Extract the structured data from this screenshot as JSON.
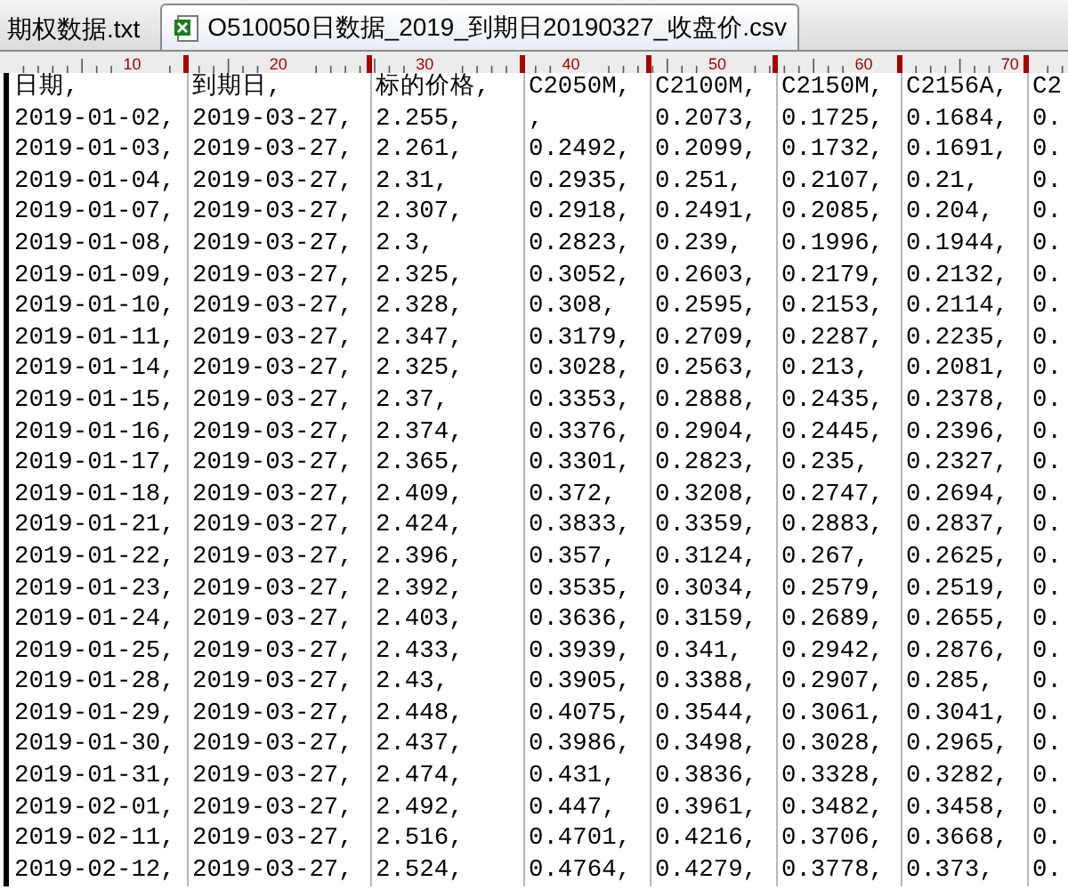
{
  "tabs": [
    {
      "label": "期权数据.txt",
      "selected": false
    },
    {
      "label": "O510050日数据_2019_到期日20190327_收盘价.csv",
      "selected": true
    }
  ],
  "ruler": {
    "labels": [
      "10",
      "20",
      "30",
      "40",
      "50",
      "60",
      "70"
    ]
  },
  "table": {
    "columns": [
      "日期,",
      "到期日,",
      "标的价格,",
      "C2050M,",
      "C2100M,",
      "C2150M,",
      "C2156A,",
      "C2"
    ],
    "rows": [
      [
        "2019-01-02,",
        "2019-03-27,",
        "2.255,",
        ",",
        "0.2073,",
        "0.1725,",
        "0.1684,",
        "0."
      ],
      [
        "2019-01-03,",
        "2019-03-27,",
        "2.261,",
        "0.2492,",
        "0.2099,",
        "0.1732,",
        "0.1691,",
        "0."
      ],
      [
        "2019-01-04,",
        "2019-03-27,",
        "2.31,",
        "0.2935,",
        "0.251,",
        "0.2107,",
        "0.21,",
        "0."
      ],
      [
        "2019-01-07,",
        "2019-03-27,",
        "2.307,",
        "0.2918,",
        "0.2491,",
        "0.2085,",
        "0.204,",
        "0."
      ],
      [
        "2019-01-08,",
        "2019-03-27,",
        "2.3,",
        "0.2823,",
        "0.239,",
        "0.1996,",
        "0.1944,",
        "0."
      ],
      [
        "2019-01-09,",
        "2019-03-27,",
        "2.325,",
        "0.3052,",
        "0.2603,",
        "0.2179,",
        "0.2132,",
        "0."
      ],
      [
        "2019-01-10,",
        "2019-03-27,",
        "2.328,",
        "0.308,",
        "0.2595,",
        "0.2153,",
        "0.2114,",
        "0."
      ],
      [
        "2019-01-11,",
        "2019-03-27,",
        "2.347,",
        "0.3179,",
        "0.2709,",
        "0.2287,",
        "0.2235,",
        "0."
      ],
      [
        "2019-01-14,",
        "2019-03-27,",
        "2.325,",
        "0.3028,",
        "0.2563,",
        "0.213,",
        "0.2081,",
        "0."
      ],
      [
        "2019-01-15,",
        "2019-03-27,",
        "2.37,",
        "0.3353,",
        "0.2888,",
        "0.2435,",
        "0.2378,",
        "0."
      ],
      [
        "2019-01-16,",
        "2019-03-27,",
        "2.374,",
        "0.3376,",
        "0.2904,",
        "0.2445,",
        "0.2396,",
        "0."
      ],
      [
        "2019-01-17,",
        "2019-03-27,",
        "2.365,",
        "0.3301,",
        "0.2823,",
        "0.235,",
        "0.2327,",
        "0."
      ],
      [
        "2019-01-18,",
        "2019-03-27,",
        "2.409,",
        "0.372,",
        "0.3208,",
        "0.2747,",
        "0.2694,",
        "0."
      ],
      [
        "2019-01-21,",
        "2019-03-27,",
        "2.424,",
        "0.3833,",
        "0.3359,",
        "0.2883,",
        "0.2837,",
        "0."
      ],
      [
        "2019-01-22,",
        "2019-03-27,",
        "2.396,",
        "0.357,",
        "0.3124,",
        "0.267,",
        "0.2625,",
        "0."
      ],
      [
        "2019-01-23,",
        "2019-03-27,",
        "2.392,",
        "0.3535,",
        "0.3034,",
        "0.2579,",
        "0.2519,",
        "0."
      ],
      [
        "2019-01-24,",
        "2019-03-27,",
        "2.403,",
        "0.3636,",
        "0.3159,",
        "0.2689,",
        "0.2655,",
        "0."
      ],
      [
        "2019-01-25,",
        "2019-03-27,",
        "2.433,",
        "0.3939,",
        "0.341,",
        "0.2942,",
        "0.2876,",
        "0."
      ],
      [
        "2019-01-28,",
        "2019-03-27,",
        "2.43,",
        "0.3905,",
        "0.3388,",
        "0.2907,",
        "0.285,",
        "0."
      ],
      [
        "2019-01-29,",
        "2019-03-27,",
        "2.448,",
        "0.4075,",
        "0.3544,",
        "0.3061,",
        "0.3041,",
        "0."
      ],
      [
        "2019-01-30,",
        "2019-03-27,",
        "2.437,",
        "0.3986,",
        "0.3498,",
        "0.3028,",
        "0.2965,",
        "0."
      ],
      [
        "2019-01-31,",
        "2019-03-27,",
        "2.474,",
        "0.431,",
        "0.3836,",
        "0.3328,",
        "0.3282,",
        "0."
      ],
      [
        "2019-02-01,",
        "2019-03-27,",
        "2.492,",
        "0.447,",
        "0.3961,",
        "0.3482,",
        "0.3458,",
        "0."
      ],
      [
        "2019-02-11,",
        "2019-03-27,",
        "2.516,",
        "0.4701,",
        "0.4216,",
        "0.3706,",
        "0.3668,",
        "0."
      ],
      [
        "2019-02-12,",
        "2019-03-27,",
        "2.524,",
        "0.4764,",
        "0.4279,",
        "0.3778,",
        "0.373,",
        "0."
      ]
    ]
  }
}
